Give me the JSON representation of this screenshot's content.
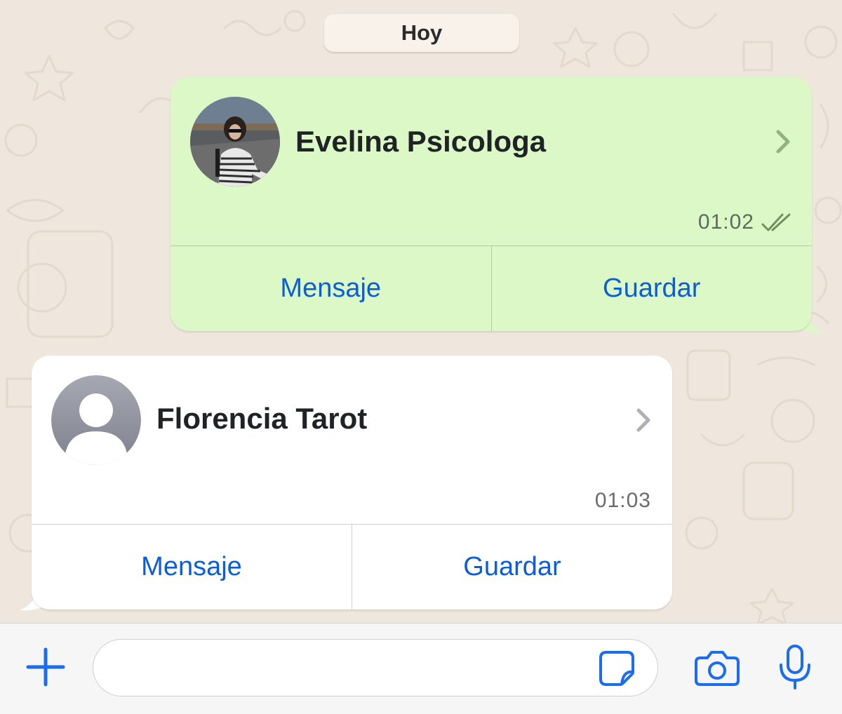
{
  "date_separator": "Hoy",
  "messages": [
    {
      "direction": "outgoing",
      "type": "contact",
      "contact_name": "Evelina Psicologa",
      "avatar": "photo-avatar",
      "time": "01:02",
      "status_icon": "double-check-icon",
      "actions": [
        "Mensaje",
        "Guardar"
      ]
    },
    {
      "direction": "incoming",
      "type": "contact",
      "contact_name": "Florencia Tarot",
      "avatar": "default-person-avatar",
      "time": "01:03",
      "actions": [
        "Mensaje",
        "Guardar"
      ]
    }
  ],
  "input_bar": {
    "attach_icon": "plus-icon",
    "text_value": "",
    "sticker_icon": "sticker-icon",
    "camera_icon": "camera-icon",
    "mic_icon": "microphone-icon"
  },
  "colors": {
    "wallpaper": "#efe7dd",
    "outgoing_bubble": "#dcf8c6",
    "incoming_bubble": "#ffffff",
    "action_blue": "#0a5fd6",
    "accent_blue": "#1a6cf0"
  }
}
